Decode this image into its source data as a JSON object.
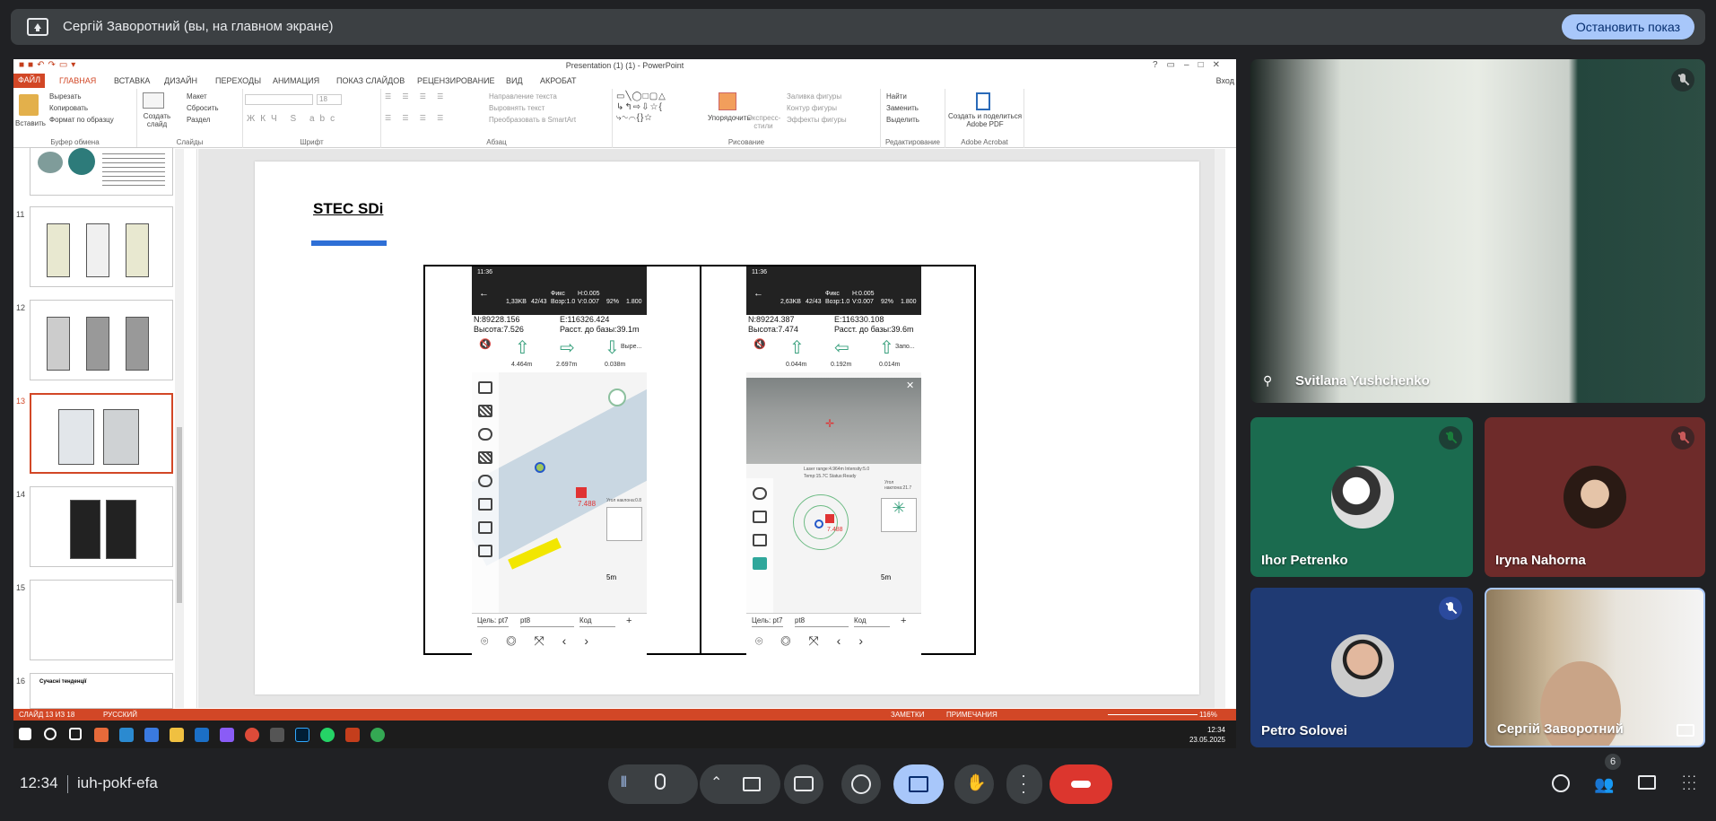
{
  "banner": {
    "title": "Сергій Заворотний (вы, на главном экране)",
    "stop_label": "Остановить показ"
  },
  "ppt": {
    "window_title": "Presentation (1) (1) - PowerPoint",
    "tabs": [
      "ФАЙЛ",
      "ГЛАВНАЯ",
      "ВСТАВКА",
      "ДИЗАЙН",
      "ПЕРЕХОДЫ",
      "АНИМАЦИЯ",
      "ПОКАЗ СЛАЙДОВ",
      "РЕЦЕНЗИРОВАНИЕ",
      "ВИД",
      "АКРОБАТ"
    ],
    "signin": "Вход",
    "ribbon": {
      "paste": "Вставить",
      "cut": "Вырезать",
      "copy": "Копировать",
      "format_painter": "Формат по образцу",
      "clipboard": "Буфер обмена",
      "new_slide": "Создать слайд",
      "layout": "Макет",
      "reset": "Сбросить",
      "section": "Раздел",
      "slides": "Слайды",
      "font_size": "18",
      "font": "Шрифт",
      "text_direction": "Направление текста",
      "align_text": "Выровнять текст",
      "smartart": "Преобразовать в SmartArt",
      "paragraph": "Абзац",
      "arrange": "Упорядочить",
      "quick_styles": "Экспресс-стили",
      "shape_fill": "Заливка фигуры",
      "shape_outline": "Контур фигуры",
      "shape_effects": "Эффекты фигуры",
      "drawing": "Рисование",
      "find": "Найти",
      "replace": "Заменить",
      "select": "Выделить",
      "editing": "Редактирование",
      "adobe_create": "Создать и поделиться Adobe PDF",
      "adobe_acrobat": "Adobe Acrobat"
    },
    "thumbnails": [
      {
        "num": "",
        "label": ""
      },
      {
        "num": "11",
        "label": ""
      },
      {
        "num": "12",
        "label": ""
      },
      {
        "num": "13",
        "label": ""
      },
      {
        "num": "14",
        "label": ""
      },
      {
        "num": "15",
        "label": ""
      },
      {
        "num": "16",
        "label": "Сучасні тенденції"
      }
    ],
    "slide": {
      "title": "STEC SDi",
      "left_phone": {
        "status_time": "11:36",
        "hdr_vals": [
          "1,33KB",
          "42/43",
          "Фикс",
          "H:0.005",
          "V:0.007",
          "92%",
          "1.800"
        ],
        "hdr_sub": "Возр:1.0",
        "n": "N:89228.156",
        "e": "E:116326.424",
        "height": "Высота:7.526",
        "dist": "Расст. до базы:39.1m",
        "d1": "4.464m",
        "d2": "2.697m",
        "d3": "0.038m",
        "action": "Выре...",
        "point_val": "7.488",
        "scale": "5m",
        "target": "Цель: pt7",
        "point": "pt8",
        "code": "Код",
        "tilt": "Угол наклона:0.8"
      },
      "right_phone": {
        "status_time": "11:36",
        "hdr_vals": [
          "2,63KB",
          "42/43",
          "Фикс",
          "H:0.005",
          "V:0.007",
          "92%",
          "1.800"
        ],
        "hdr_sub": "Возр:1.0",
        "n": "N:89224.387",
        "e": "E:116330.108",
        "height": "Высота:7.474",
        "dist": "Расст. до базы:39.6m",
        "d1": "0.044m",
        "d2": "0.192m",
        "d3": "0.014m",
        "action": "Запо...",
        "laser": "Laser range:4.964m Intensity:5.0",
        "temp": "Temp:15.7C Status:Ready",
        "point_val": "7.488",
        "scale": "5m",
        "target": "Цель: pt7",
        "point": "pt8",
        "code": "Код",
        "tilt": "Угол наклона:21.7"
      }
    },
    "status": {
      "slide_info": "СЛАЙД 13 ИЗ 18",
      "language": "РУССКИЙ",
      "notes": "ЗАМЕТКИ",
      "comments": "ПРИМЕЧАНИЯ",
      "zoom": "116%"
    },
    "tray_time": "12:34",
    "tray_date": "23.05.2025"
  },
  "participants": [
    {
      "name": "Svitlana Yushchenko",
      "pinned": true
    },
    {
      "name": "Ihor Petrenko"
    },
    {
      "name": "Iryna Nahorna"
    },
    {
      "name": "Petro Solovei"
    },
    {
      "name": "Сергій Заворотний"
    }
  ],
  "bottom": {
    "time": "12:34",
    "meeting_code": "iuh-pokf-efa",
    "people_count": "6"
  },
  "colors": {
    "accent": "#a8c7fa",
    "end_call": "#dc362e",
    "ppt_orange": "#d24726",
    "slide_bar": "#2e6fd6"
  }
}
